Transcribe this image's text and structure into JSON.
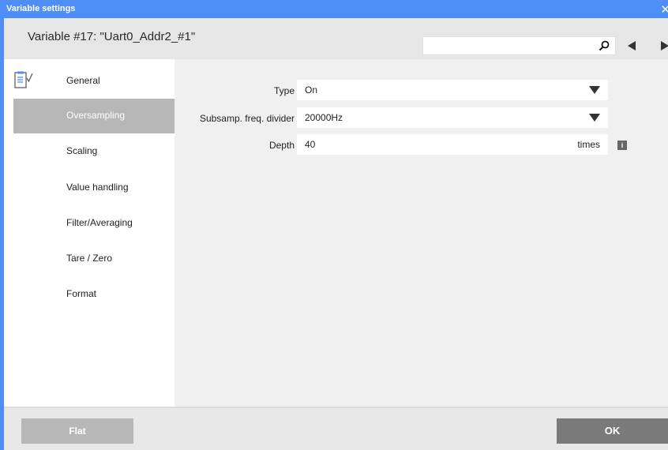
{
  "window": {
    "title": "Variable settings",
    "close_icon": "close-icon"
  },
  "header": {
    "heading": "Variable #17: \"Uart0_Addr2_#1\"",
    "search_value": "",
    "search_placeholder": "",
    "icons": [
      "search-icon",
      "prev-arrow-icon",
      "next-arrow-icon"
    ]
  },
  "sidebar": {
    "items": [
      {
        "label": "General",
        "icon": "clipboard-check-icon",
        "active": false
      },
      {
        "label": "Oversampling",
        "active": true
      },
      {
        "label": "Scaling",
        "active": false
      },
      {
        "label": "Value handling",
        "active": false
      },
      {
        "label": "Filter/Averaging",
        "active": false
      },
      {
        "label": "Tare / Zero",
        "active": false
      },
      {
        "label": "Format",
        "active": false
      }
    ]
  },
  "form": {
    "type": {
      "label": "Type",
      "value": "On"
    },
    "divider": {
      "label": "Subsamp. freq. divider",
      "value": "20000Hz"
    },
    "depth": {
      "label": "Depth",
      "value": "40",
      "unit": "times",
      "info_icon": "i"
    }
  },
  "footer": {
    "flat_label": "Flat",
    "ok_label": "OK"
  },
  "colors": {
    "accent": "#4f8ef7",
    "active_item": "#b7b7b7",
    "ok_button": "#7a7a7a"
  }
}
